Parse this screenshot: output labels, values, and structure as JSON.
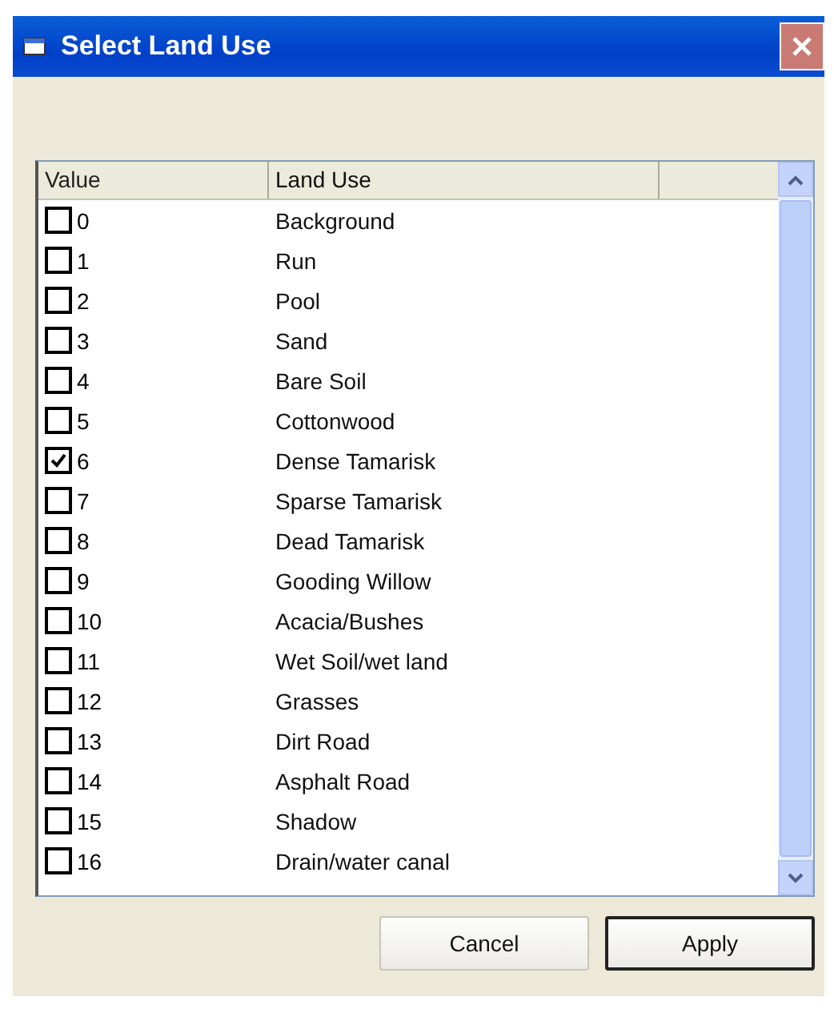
{
  "window": {
    "title": "Select Land Use"
  },
  "table": {
    "columns": [
      "Value",
      "Land Use"
    ],
    "rows": [
      {
        "value": "0",
        "land_use": "Background",
        "checked": false
      },
      {
        "value": "1",
        "land_use": "Run",
        "checked": false
      },
      {
        "value": "2",
        "land_use": "Pool",
        "checked": false
      },
      {
        "value": "3",
        "land_use": "Sand",
        "checked": false
      },
      {
        "value": "4",
        "land_use": "Bare Soil",
        "checked": false
      },
      {
        "value": "5",
        "land_use": "Cottonwood",
        "checked": false
      },
      {
        "value": "6",
        "land_use": "Dense Tamarisk",
        "checked": true
      },
      {
        "value": "7",
        "land_use": "Sparse Tamarisk",
        "checked": false
      },
      {
        "value": "8",
        "land_use": "Dead Tamarisk",
        "checked": false
      },
      {
        "value": "9",
        "land_use": "Gooding Willow",
        "checked": false
      },
      {
        "value": "10",
        "land_use": "Acacia/Bushes",
        "checked": false
      },
      {
        "value": "11",
        "land_use": "Wet Soil/wet land",
        "checked": false
      },
      {
        "value": "12",
        "land_use": "Grasses",
        "checked": false
      },
      {
        "value": "13",
        "land_use": "Dirt Road",
        "checked": false
      },
      {
        "value": "14",
        "land_use": "Asphalt Road",
        "checked": false
      },
      {
        "value": "15",
        "land_use": "Shadow",
        "checked": false
      },
      {
        "value": "16",
        "land_use": "Drain/water canal",
        "checked": false
      }
    ]
  },
  "buttons": [
    "Cancel",
    "Apply"
  ]
}
